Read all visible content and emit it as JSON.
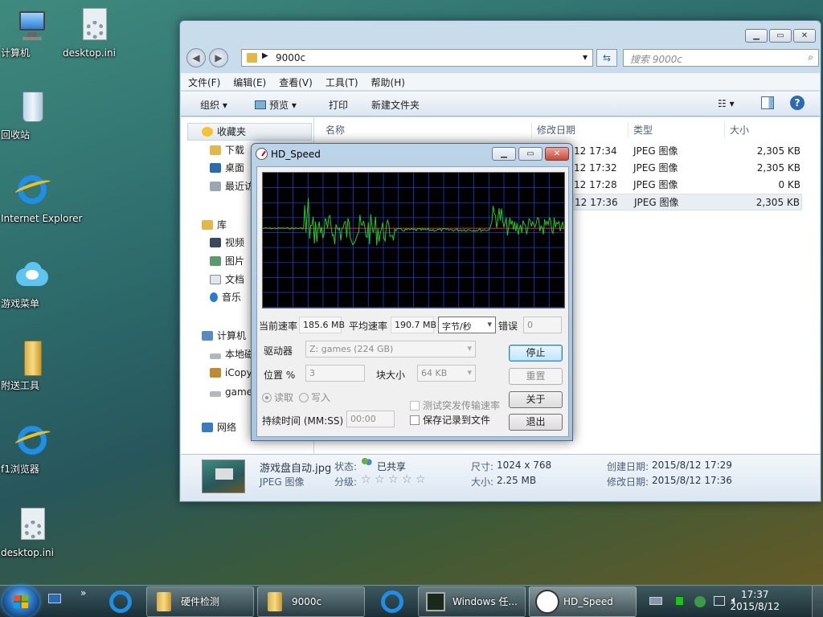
{
  "desktop": {
    "icons": [
      {
        "label": "计算机"
      },
      {
        "label": "desktop.ini"
      },
      {
        "label": "回收站"
      },
      {
        "label": "Internet Explorer"
      },
      {
        "label": "游戏菜单"
      },
      {
        "label": "附送工具"
      },
      {
        "label": "f1浏览器"
      },
      {
        "label": "desktop.ini"
      }
    ]
  },
  "explorer": {
    "address": "9000c",
    "search_placeholder": "搜索 9000c",
    "menu": [
      "文件(F)",
      "编辑(E)",
      "查看(V)",
      "工具(T)",
      "帮助(H)"
    ],
    "toolbar": {
      "organize": "组织",
      "preview": "预览",
      "print": "打印",
      "new_folder": "新建文件夹"
    },
    "nav": {
      "favorites": "收藏夹",
      "downloads": "下载",
      "desktop": "桌面",
      "recent": "最近访",
      "libraries": "库",
      "videos": "视频",
      "pictures": "图片",
      "documents": "文档",
      "music": "音乐",
      "computer": "计算机",
      "local_disk": "本地磁",
      "icopy": "iCopy",
      "games": "game",
      "network": "网络"
    },
    "columns": {
      "name": "名称",
      "date": "修改日期",
      "type": "类型",
      "size": "大小"
    },
    "rows": [
      {
        "date": "12 17:34",
        "type": "JPEG 图像",
        "size": "2,305 KB"
      },
      {
        "date": "12 17:32",
        "type": "JPEG 图像",
        "size": "2,305 KB"
      },
      {
        "date": "12 17:28",
        "type": "JPEG 图像",
        "size": "0 KB"
      },
      {
        "date": "12 17:36",
        "type": "JPEG 图像",
        "size": "2,305 KB"
      }
    ],
    "details": {
      "filename": "游戏盘自动.jpg",
      "filetype": "JPEG 图像",
      "status_label": "状态:",
      "status_value": "已共享",
      "rating_label": "分级:",
      "stars": "☆ ☆ ☆ ☆ ☆",
      "dimensions_label": "尺寸:",
      "dimensions": "1024 x 768",
      "size_label": "大小:",
      "size": "2.25 MB",
      "created_label": "创建日期:",
      "created": "2015/8/12 17:29",
      "modified_label": "修改日期:",
      "modified": "2015/8/12 17:36"
    }
  },
  "hdspeed": {
    "title": "HD_Speed",
    "current_rate_label": "当前速率",
    "current_rate": "185.6 MB",
    "avg_rate_label": "平均速率",
    "avg_rate": "190.7 MB",
    "unit": "字节/秒",
    "error_label": "错误",
    "error_value": "0",
    "drive_label": "驱动器",
    "drive_value": "Z: games (224 GB)",
    "position_label": "位置 %",
    "position_value": "3",
    "block_label": "块大小",
    "block_value": "64 KB",
    "read_label": "读取",
    "write_label": "写入",
    "burst_label": "测试突发传输速率",
    "save_log_label": "保存记录到文件",
    "duration_label": "持续时间 (MM:SS)",
    "duration_value": "00:00",
    "buttons": {
      "stop": "停止",
      "reset": "重置",
      "about": "关于",
      "exit": "退出"
    }
  },
  "taskbar": {
    "tasks": [
      {
        "label": "硬件检测"
      },
      {
        "label": "9000c"
      },
      {
        "label": "Windows 任..."
      },
      {
        "label": "HD_Speed"
      }
    ],
    "time": "17:37",
    "date": "2015/8/12"
  },
  "colors": {
    "graph_bg": "#000000",
    "graph_grid": "#1a3fd0",
    "graph_line": "#22cc22",
    "graph_avg": "#e02020",
    "accent": "#3c7fb1"
  }
}
